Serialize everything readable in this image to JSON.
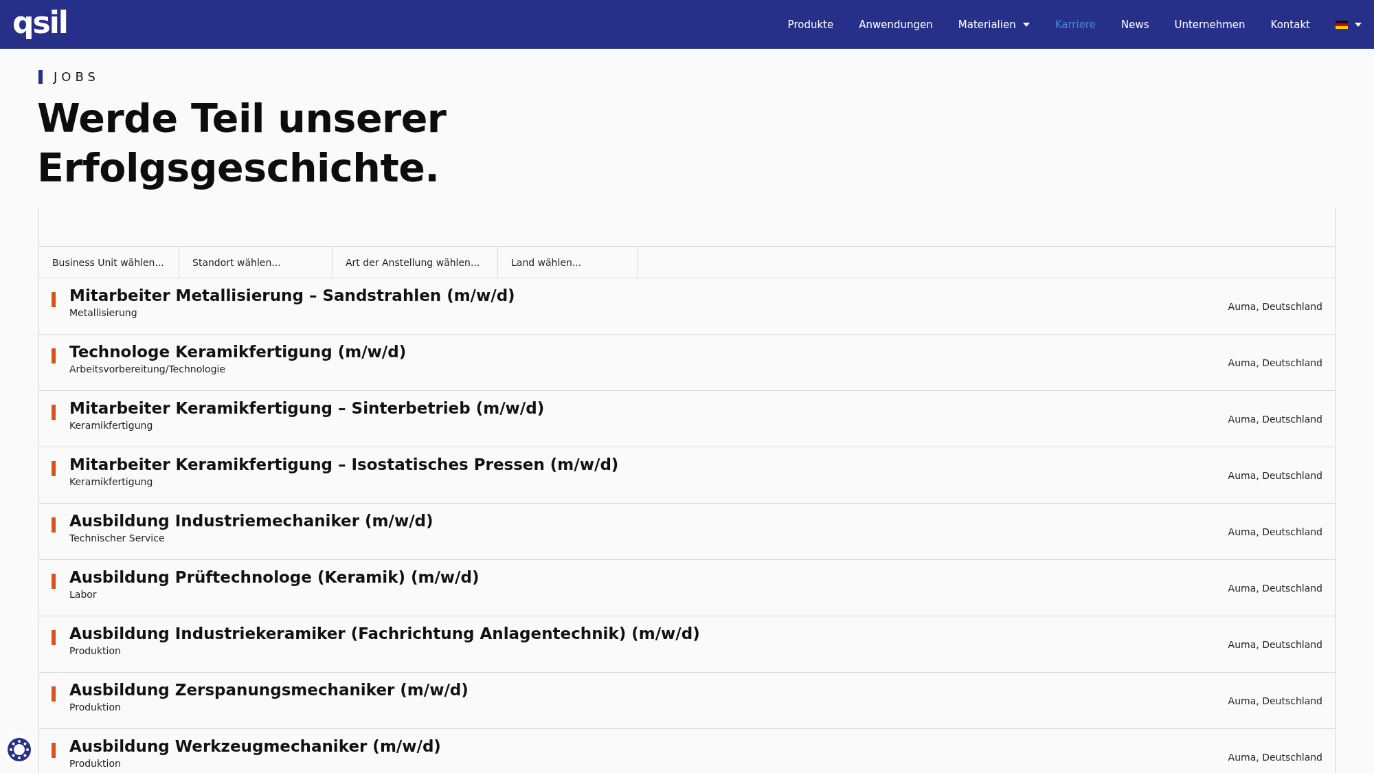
{
  "header": {
    "logo": "qsil",
    "nav": [
      {
        "label": "Produkte",
        "selected": false,
        "dropdown": false
      },
      {
        "label": "Anwendungen",
        "selected": false,
        "dropdown": false
      },
      {
        "label": "Materialien",
        "selected": false,
        "dropdown": true
      },
      {
        "label": "Karriere",
        "selected": true,
        "dropdown": false
      },
      {
        "label": "News",
        "selected": false,
        "dropdown": false
      },
      {
        "label": "Unternehmen",
        "selected": false,
        "dropdown": false
      },
      {
        "label": "Kontakt",
        "selected": false,
        "dropdown": false
      }
    ]
  },
  "section_label": "JOBS",
  "headline": [
    "Werde Teil unserer",
    "Erfolgsgeschichte."
  ],
  "filters": [
    "Business Unit wählen...",
    "Standort wählen...",
    "Art der Anstellung wählen...",
    "Land wählen..."
  ],
  "jobs": [
    {
      "title": "Mitarbeiter Metallisierung – Sandstrahlen (m/w/d)",
      "department": "Metallisierung",
      "location": "Auma, Deutschland"
    },
    {
      "title": "Technologe Keramikfertigung (m/w/d)",
      "department": "Arbeitsvorbereitung/Technologie",
      "location": "Auma, Deutschland"
    },
    {
      "title": "Mitarbeiter Keramikfertigung – Sinterbetrieb (m/w/d)",
      "department": "Keramikfertigung",
      "location": "Auma, Deutschland"
    },
    {
      "title": "Mitarbeiter Keramikfertigung – Isostatisches Pressen (m/w/d)",
      "department": "Keramikfertigung",
      "location": "Auma, Deutschland"
    },
    {
      "title": "Ausbildung Industriemechaniker (m/w/d)",
      "department": "Technischer Service",
      "location": "Auma, Deutschland"
    },
    {
      "title": "Ausbildung Prüftechnologe (Keramik) (m/w/d)",
      "department": "Labor",
      "location": "Auma, Deutschland"
    },
    {
      "title": "Ausbildung Industriekeramiker (Fachrichtung Anlagentechnik) (m/w/d)",
      "department": "Produktion",
      "location": "Auma, Deutschland"
    },
    {
      "title": "Ausbildung Zerspanungsmechaniker (m/w/d)",
      "department": "Produktion",
      "location": "Auma, Deutschland"
    },
    {
      "title": "Ausbildung Werkzeugmechaniker (m/w/d)",
      "department": "Produktion",
      "location": "Auma, Deutschland"
    }
  ]
}
